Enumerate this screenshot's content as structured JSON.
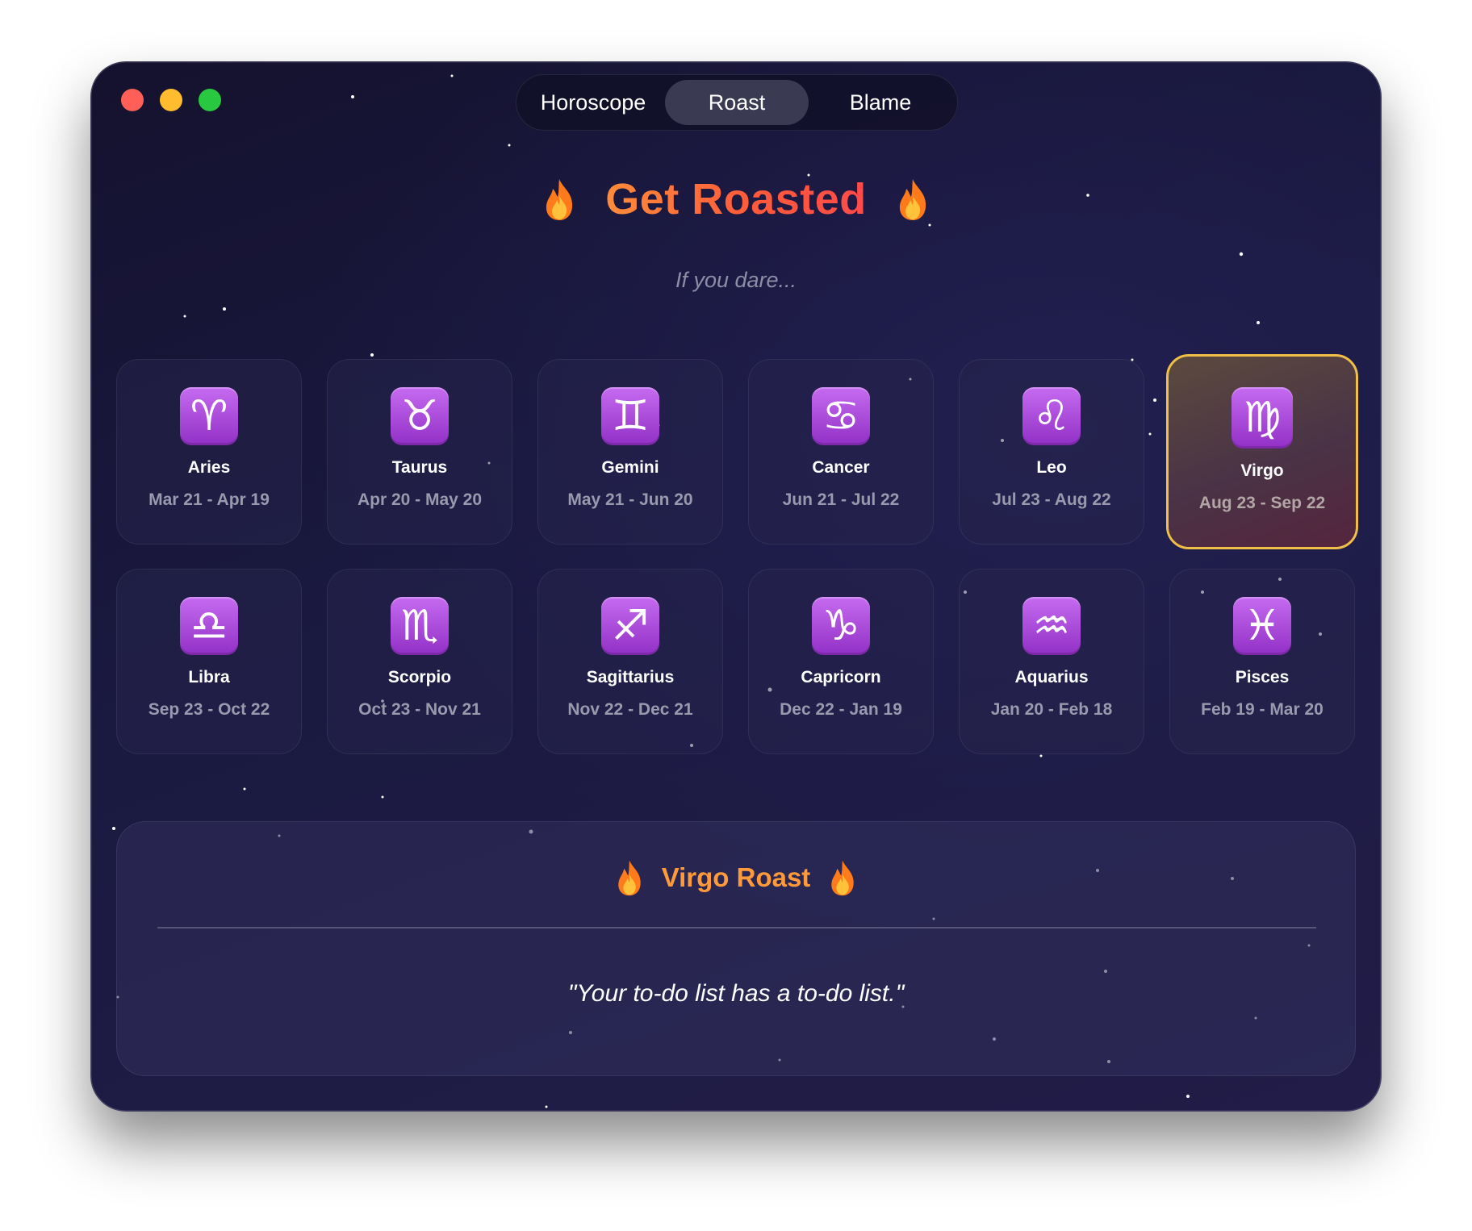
{
  "tabs": [
    {
      "label": "Horoscope",
      "active": false
    },
    {
      "label": "Roast",
      "active": true
    },
    {
      "label": "Blame",
      "active": false
    }
  ],
  "header": {
    "title": "Get Roasted",
    "subtitle": "If you dare...",
    "decor_icon": "fire-icon"
  },
  "signs": [
    {
      "name": "Aries",
      "dates": "Mar 21 - Apr 19",
      "glyph": "♈",
      "icon": "aries-icon"
    },
    {
      "name": "Taurus",
      "dates": "Apr 20 - May 20",
      "glyph": "♉",
      "icon": "taurus-icon"
    },
    {
      "name": "Gemini",
      "dates": "May 21 - Jun 20",
      "glyph": "♊",
      "icon": "gemini-icon"
    },
    {
      "name": "Cancer",
      "dates": "Jun 21 - Jul 22",
      "glyph": "♋",
      "icon": "cancer-icon"
    },
    {
      "name": "Leo",
      "dates": "Jul 23 - Aug 22",
      "glyph": "♌",
      "icon": "leo-icon"
    },
    {
      "name": "Virgo",
      "dates": "Aug 23 - Sep 22",
      "glyph": "♍",
      "icon": "virgo-icon",
      "selected": true
    },
    {
      "name": "Libra",
      "dates": "Sep 23 - Oct 22",
      "glyph": "♎",
      "icon": "libra-icon"
    },
    {
      "name": "Scorpio",
      "dates": "Oct 23 - Nov 21",
      "glyph": "♏",
      "icon": "scorpio-icon"
    },
    {
      "name": "Sagittarius",
      "dates": "Nov 22 - Dec 21",
      "glyph": "♐",
      "icon": "sagittarius-icon"
    },
    {
      "name": "Capricorn",
      "dates": "Dec 22 - Jan 19",
      "glyph": "♑",
      "icon": "capricorn-icon"
    },
    {
      "name": "Aquarius",
      "dates": "Jan 20 - Feb 18",
      "glyph": "♒",
      "icon": "aquarius-icon"
    },
    {
      "name": "Pisces",
      "dates": "Feb 19 - Mar 20",
      "glyph": "♓",
      "icon": "pisces-icon"
    }
  ],
  "roast": {
    "title": "Virgo Roast",
    "text": "\"Your to-do list has a to-do list.\""
  },
  "colors": {
    "accent_orange": "#ff9a3a",
    "title_gradient_start": "#ff8c3a",
    "title_gradient_end": "#ff4a4a",
    "selected_border": "#f0bf46",
    "icon_purple": "#b055e0"
  }
}
